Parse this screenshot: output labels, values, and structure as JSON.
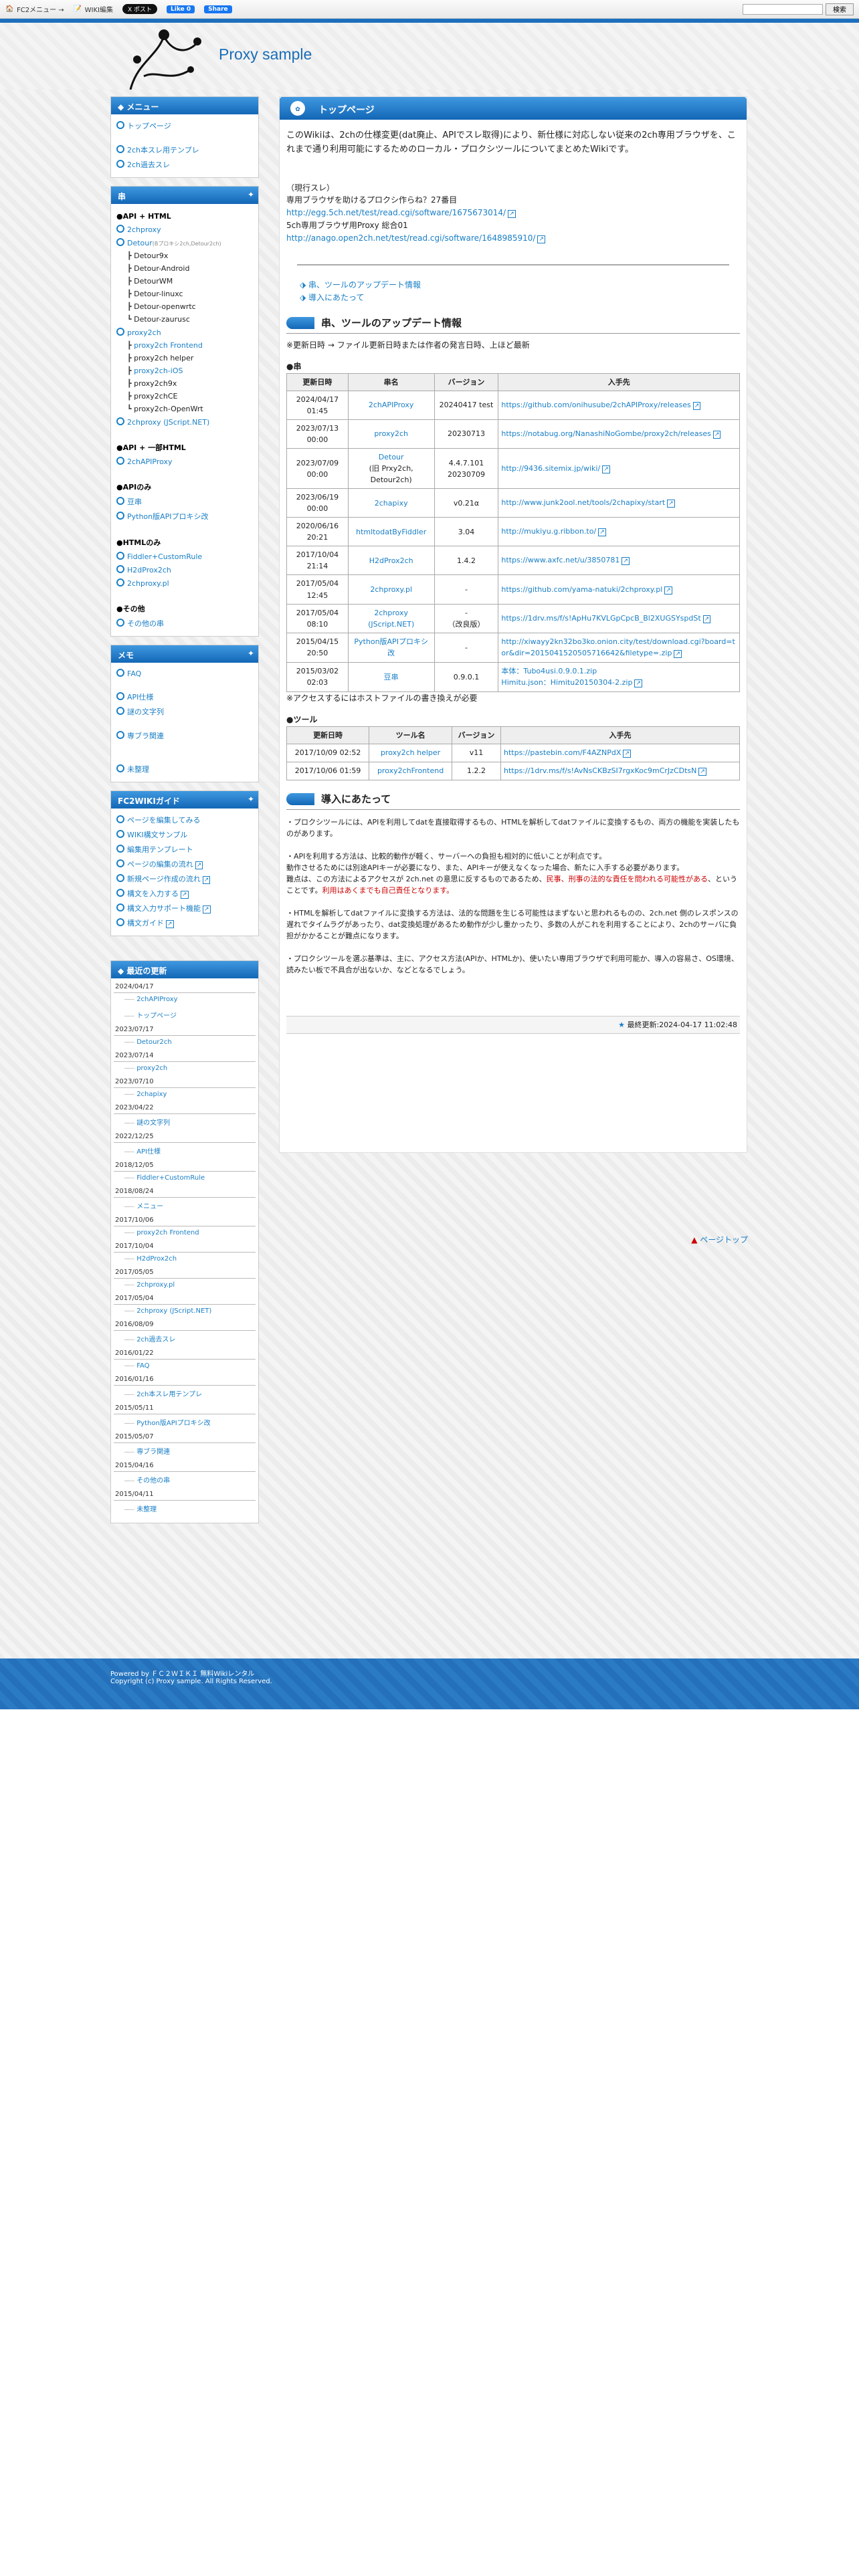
{
  "topbar": {
    "fc2_menu": "FC2メニュー →",
    "wiki_edit": "WIKI編集",
    "xpost": "X ポスト",
    "fb_like": "Like 0",
    "fb_share": "Share",
    "search_btn": "検索"
  },
  "site": {
    "title": "Proxy sample"
  },
  "menu": {
    "title": "メニュー",
    "items": [
      "トップページ",
      "2ch本スレ用テンプレ",
      "2ch過去スレ"
    ]
  },
  "kushi": {
    "title": "串",
    "h_api_html": "●API + HTML",
    "twoch_proxy": "2chproxy",
    "detour": "Detour",
    "detour_note": "(Bプロキシ2ch,Detour2ch)",
    "detour_subs": [
      "Detour9x",
      "Detour-Android",
      "DetourWM",
      "Detour-linuxc",
      "Detour-openwrtc",
      "Detour-zaurusc"
    ],
    "proxy2ch": "proxy2ch",
    "proxy2ch_subs": [
      "proxy2ch Frontend",
      "proxy2ch helper",
      "proxy2ch-iOS",
      "proxy2ch9x",
      "proxy2chCE",
      "proxy2ch-OpenWrt"
    ],
    "jscript": "2chproxy (JScript.NET)",
    "h_api_dat": "●API + 一部HTML",
    "chapi": "2chAPIProxy",
    "h_api_only": "●APIのみ",
    "tofu": "豆串",
    "python": "Python版APIプロキシ改",
    "h_html": "●HTMLのみ",
    "fiddler": "Fiddler+CustomRule",
    "h2d": "H2dProx2ch",
    "pl": "2chproxy.pl",
    "h_other": "●その他",
    "other_kushi": "その他の串"
  },
  "memo": {
    "title": "メモ",
    "faq": "FAQ",
    "api": "API仕様",
    "nazo": "謎の文字列",
    "senpura": "専ブラ関連",
    "mitou": "未整理"
  },
  "guide": {
    "title": "FC2WIKIガイド",
    "items": [
      "ページを編集してみる",
      "WIKI構文サンプル",
      "編集用テンプレート",
      "ページの編集の流れ",
      "新規ページ作成の流れ",
      "構文を入力する",
      "構文入力サポート機能",
      "構文ガイド"
    ]
  },
  "recent": {
    "title": "最近の更新",
    "entries": [
      {
        "date": "2024/04/17",
        "pages": [
          "2chAPIProxy",
          "トップページ"
        ]
      },
      {
        "date": "2023/07/17",
        "pages": [
          "Detour2ch"
        ]
      },
      {
        "date": "2023/07/14",
        "pages": [
          "proxy2ch"
        ]
      },
      {
        "date": "2023/07/10",
        "pages": [
          "2chapixy"
        ]
      },
      {
        "date": "2023/04/22",
        "pages": [
          "謎の文字列"
        ]
      },
      {
        "date": "2022/12/25",
        "pages": [
          "API仕様"
        ]
      },
      {
        "date": "2018/12/05",
        "pages": [
          "Fiddler+CustomRule"
        ]
      },
      {
        "date": "2018/08/24",
        "pages": [
          "メニュー"
        ]
      },
      {
        "date": "2017/10/06",
        "pages": [
          "proxy2ch Frontend"
        ]
      },
      {
        "date": "2017/10/04",
        "pages": [
          "H2dProx2ch"
        ]
      },
      {
        "date": "2017/05/05",
        "pages": [
          "2chproxy.pl"
        ]
      },
      {
        "date": "2017/05/04",
        "pages": [
          "2chproxy (JScript.NET)"
        ]
      },
      {
        "date": "2016/08/09",
        "pages": [
          "2ch過去スレ"
        ]
      },
      {
        "date": "2016/01/22",
        "pages": [
          "FAQ"
        ]
      },
      {
        "date": "2016/01/16",
        "pages": [
          "2ch本スレ用テンプレ"
        ]
      },
      {
        "date": "2015/05/11",
        "pages": [
          "Python版APIプロキシ改"
        ]
      },
      {
        "date": "2015/05/07",
        "pages": [
          "専ブラ関連"
        ]
      },
      {
        "date": "2015/04/16",
        "pages": [
          "その他の串"
        ]
      },
      {
        "date": "2015/04/11",
        "pages": [
          "未整理"
        ]
      }
    ]
  },
  "page": {
    "title": "トップページ",
    "intro": "このWikiは、2chの仕様変更(dat廃止、APIでスレ取得)により、新仕様に対応しない従来の2ch専用ブラウザを、これまで通り利用可能にするためのローカル・プロクシツールについてまとめたWikiです。",
    "genko": "（現行スレ）",
    "line1": "専用ブラウザを助けるプロクシ作らね？27番目",
    "url1": "http://egg.5ch.net/test/read.cgi/software/1675673014/",
    "line2": "5ch専用ブラウザ用Proxy 総合01",
    "url2": "http://anago.open2ch.net/test/read.cgi/software/1648985910/",
    "toc1": "串、ツールのアップデート情報",
    "toc2": "導入にあたって",
    "sec1": "串、ツールのアップデート情報",
    "note1": "※更新日時 → ファイル更新日時または作者の発言日時、上ほど最新",
    "kushi_h": "●串",
    "cols": [
      "更新日時",
      "串名",
      "バージョン",
      "入手先"
    ],
    "rows": [
      {
        "d": "2024/04/17 01:45",
        "n": "2chAPIProxy",
        "v": "20240417 test",
        "u": "https://github.com/onihusube/2chAPIProxy/releases"
      },
      {
        "d": "2023/07/13 00:00",
        "n": "proxy2ch",
        "v": "20230713",
        "u": "https://notabug.org/NanashiNoGombe/proxy2ch/releases"
      },
      {
        "d": "2023/07/09 00:00",
        "n": "Detour",
        "n2": "(旧 Prxy2ch, Detour2ch)",
        "v": "4.4.7.101 20230709",
        "u": "http://9436.sitemix.jp/wiki/"
      },
      {
        "d": "2023/06/19 00:00",
        "n": "2chapixy",
        "v": "v0.21α",
        "u": "http://www.junk2ool.net/tools/2chapixy/start"
      },
      {
        "d": "2020/06/16 20:21",
        "n": "htmltodatByFiddler",
        "v": "3.04",
        "u": "http://mukiyu.g.ribbon.to/"
      },
      {
        "d": "2017/10/04 21:14",
        "n": "H2dProx2ch",
        "v": "1.4.2",
        "u": "https://www.axfc.net/u/3850781"
      },
      {
        "d": "2017/05/04 12:45",
        "n": "2chproxy.pl",
        "v": "-",
        "u": "https://github.com/yama-natuki/2chproxy.pl"
      },
      {
        "d": "2017/05/04 08:10",
        "n": "2chproxy (JScript.NET)",
        "v": "-\n（改良版）",
        "u": "https://1drv.ms/f/s!ApHu7KVLGpCpcB_Bl2XUGSYspdSt"
      },
      {
        "d": "2015/04/15 20:50",
        "n": "Python版APIプロキシ改",
        "v": "-",
        "u": "http://xiwayy2kn32bo3ko.onion.city/test/download.cgi?board=tor&dir=2015041520505716642&filetype=.zip"
      },
      {
        "d": "2015/03/02 02:03",
        "n": "豆串",
        "v": "0.9.0.1",
        "u": "本体：Tubo4usi.0.9.0.1.zip\nHimitu.json：Himitu20150304-2.zip"
      }
    ],
    "note2": "※アクセスするにはホストファイルの書き換えが必要",
    "tool_h": "●ツール",
    "tcols": [
      "更新日時",
      "ツール名",
      "バージョン",
      "入手先"
    ],
    "trows": [
      {
        "d": "2017/10/09 02:52",
        "n": "proxy2ch helper",
        "v": "v11",
        "u": "https://pastebin.com/F4AZNPdX"
      },
      {
        "d": "2017/10/06 01:59",
        "n": "proxy2chFrontend",
        "v": "1.2.2",
        "u": "https://1drv.ms/f/s!AvNsCKBzSI7rgxKoc9mCrJzCDtsN"
      }
    ],
    "sec2": "導入にあたって",
    "p1": "・プロクシツールには、APIを利用してdatを直接取得するもの、HTMLを解析してdatファイルに変換するもの、両方の機能を実装したものがあります。",
    "p2": "・APIを利用する方法は、比較的動作が軽く、サーバーへの負担も相対的に低いことが利点です。",
    "p3": "動作させるためには別途APIキーが必要になり、また、APIキーが使えなくなった場合、新たに入手する必要があります。",
    "p4a": "難点は、この方法によるアクセスが 2ch.net の意思に反するものであるため、",
    "p4b": "民事、刑事の法的な責任を問われる可能性がある",
    "p4c": "、ということです。",
    "p4d": "利用はあくまでも自己責任となります。",
    "p5": "・HTMLを解析してdatファイルに変換する方法は、法的な問題を生じる可能性はまずないと思われるものの、2ch.net 側のレスポンスの遅れでタイムラグがあったり、dat変換処理があるため動作が少し重かったり、多数の人がこれを利用することにより、2chのサーバに負担がかかることが難点になります。",
    "p6": "・プロクシツールを選ぶ基準は、主に、アクセス方法(APIか、HTMLか)、使いたい専用ブラウザで利用可能か、導入の容易さ、OS環境、読みたい板で不具合が出ないか、などとなるでしょう。",
    "last_updated": "最終更新:2024-04-17 11:02:48",
    "pagetop": "ページトップ"
  },
  "footer": {
    "line1_a": "Powered by ",
    "line1_b": "ＦＣ２ＷＩＫＩ 無料Wikiレンタル",
    "line2": "Copyright (c) Proxy sample. All Rights Reserved."
  }
}
